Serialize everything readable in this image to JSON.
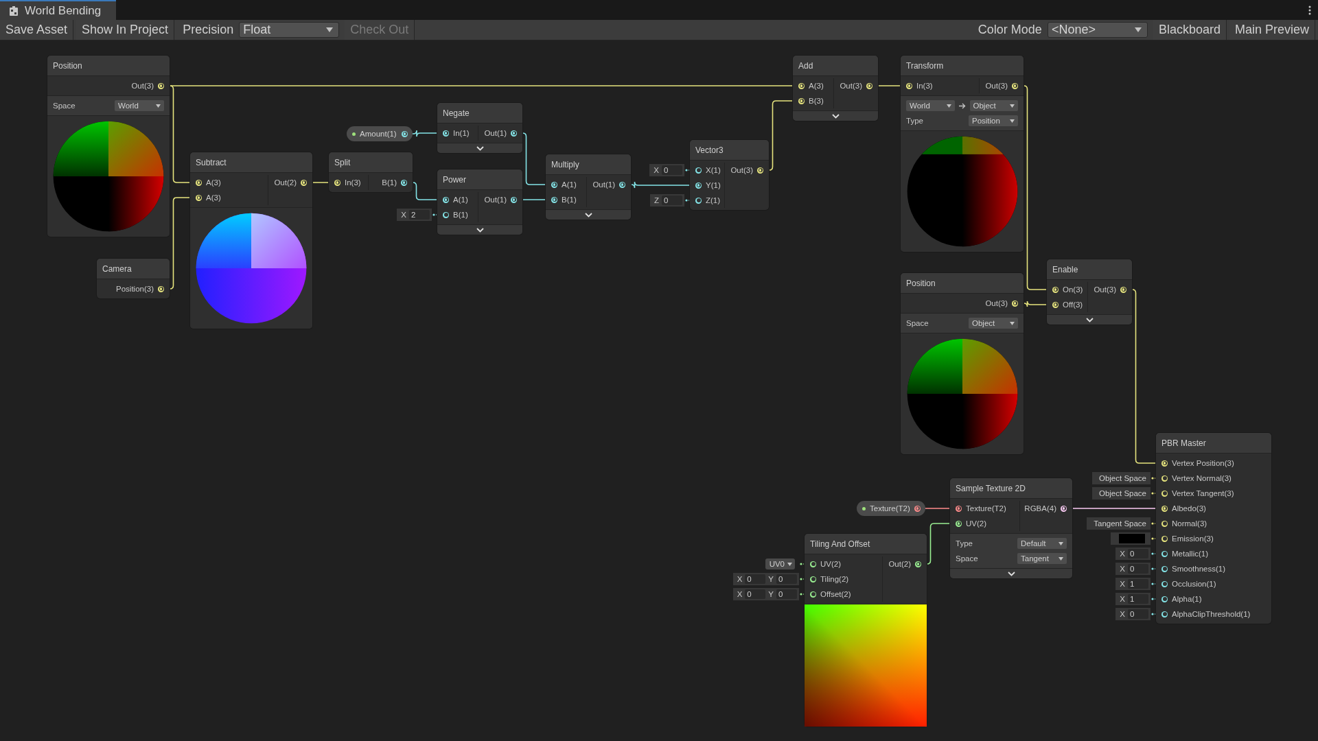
{
  "window": {
    "tab_title": "World Bending"
  },
  "toolbar": {
    "left": [
      {
        "kind": "button",
        "label": "Save Asset",
        "disabled": false
      },
      {
        "kind": "button",
        "label": "Show In Project",
        "disabled": false
      },
      {
        "kind": "dropdown",
        "label": "Precision",
        "value": "Float"
      },
      {
        "kind": "button",
        "label": "Check Out",
        "disabled": true
      }
    ],
    "right": [
      {
        "kind": "dropdown",
        "label": "Color Mode",
        "value": "<None>"
      },
      {
        "kind": "button",
        "label": "Blackboard",
        "disabled": false
      },
      {
        "kind": "button",
        "label": "Main Preview",
        "disabled": false
      }
    ]
  },
  "properties": [
    {
      "label": "Amount(1)",
      "color": "#84e4e7"
    },
    {
      "label": "Texture(T2)",
      "color": "#ff8b8b"
    }
  ],
  "nodes": [
    {
      "title": "Position",
      "outputs": [
        {
          "label": "Out(3)",
          "color": "#e6e47e",
          "connected": true
        }
      ],
      "fields": [
        {
          "kind": "dropdown",
          "label": "Space",
          "value": "World"
        }
      ],
      "preview": {
        "kind": "quadrant-sphere"
      },
      "expand_toggle": false
    },
    {
      "title": "Camera",
      "outputs": [
        {
          "label": "Position(3)",
          "color": "#e6e47e",
          "connected": true
        }
      ],
      "expand_toggle": false
    },
    {
      "title": "Subtract",
      "inputs": [
        {
          "label": "A(3)",
          "color": "#e6e47e",
          "connected": true
        },
        {
          "label": "A(3)",
          "color": "#e6e47e",
          "connected": true
        }
      ],
      "outputs": [
        {
          "label": "Out(2)",
          "color": "#e6e47e",
          "connected": true
        }
      ],
      "preview": {
        "kind": "blue-sphere"
      },
      "expand_toggle": false
    },
    {
      "title": "Split",
      "inputs": [
        {
          "label": "In(3)",
          "color": "#e6e47e",
          "connected": true
        }
      ],
      "outputs": [
        {
          "label": "B(1)",
          "color": "#84e4e7",
          "connected": true
        }
      ],
      "expand_toggle": false
    },
    {
      "title": "Negate",
      "inputs": [
        {
          "label": "In(1)",
          "color": "#84e4e7",
          "connected": true
        }
      ],
      "outputs": [
        {
          "label": "Out(1)",
          "color": "#84e4e7",
          "connected": true
        }
      ],
      "expand_toggle": true
    },
    {
      "title": "Power",
      "inputs": [
        {
          "label": "A(1)",
          "color": "#84e4e7",
          "connected": true
        },
        {
          "label": "B(1)",
          "color": "#84e4e7",
          "connected": false,
          "default": {
            "kind": "vector",
            "fields": [
              {
                "axis": "X",
                "value": "2"
              }
            ]
          }
        }
      ],
      "outputs": [
        {
          "label": "Out(1)",
          "color": "#84e4e7",
          "connected": true
        }
      ],
      "expand_toggle": true
    },
    {
      "title": "Multiply",
      "inputs": [
        {
          "label": "A(1)",
          "color": "#84e4e7",
          "connected": true
        },
        {
          "label": "B(1)",
          "color": "#84e4e7",
          "connected": true
        }
      ],
      "outputs": [
        {
          "label": "Out(1)",
          "color": "#84e4e7",
          "connected": true
        }
      ],
      "expand_toggle": true
    },
    {
      "title": "Vector3",
      "inputs": [
        {
          "label": "X(1)",
          "color": "#84e4e7",
          "connected": false,
          "default": {
            "kind": "vector",
            "fields": [
              {
                "axis": "X",
                "value": "0"
              }
            ]
          }
        },
        {
          "label": "Y(1)",
          "color": "#84e4e7",
          "connected": true
        },
        {
          "label": "Z(1)",
          "color": "#84e4e7",
          "connected": false,
          "default": {
            "kind": "vector",
            "fields": [
              {
                "axis": "Z",
                "value": "0"
              }
            ]
          }
        }
      ],
      "outputs": [
        {
          "label": "Out(3)",
          "color": "#e6e47e",
          "connected": true
        }
      ],
      "expand_toggle": false
    },
    {
      "title": "Add",
      "inputs": [
        {
          "label": "A(3)",
          "color": "#e6e47e",
          "connected": true
        },
        {
          "label": "B(3)",
          "color": "#e6e47e",
          "connected": true
        }
      ],
      "outputs": [
        {
          "label": "Out(3)",
          "color": "#e6e47e",
          "connected": true
        }
      ],
      "expand_toggle": true
    },
    {
      "title": "Transform",
      "inputs": [
        {
          "label": "In(3)",
          "color": "#e6e47e",
          "connected": true
        }
      ],
      "outputs": [
        {
          "label": "Out(3)",
          "color": "#e6e47e",
          "connected": true
        }
      ],
      "fields": [
        {
          "kind": "conversion",
          "from": "World",
          "to": "Object"
        },
        {
          "kind": "dropdown",
          "label": "Type",
          "value": "Position"
        }
      ],
      "preview": {
        "kind": "red-sphere"
      },
      "expand_toggle": false
    },
    {
      "title": "Position",
      "outputs": [
        {
          "label": "Out(3)",
          "color": "#e6e47e",
          "connected": true
        }
      ],
      "fields": [
        {
          "kind": "dropdown",
          "label": "Space",
          "value": "Object"
        }
      ],
      "preview": {
        "kind": "quadrant-sphere"
      },
      "expand_toggle": false
    },
    {
      "title": "Enable",
      "inputs": [
        {
          "label": "On(3)",
          "color": "#e6e47e",
          "connected": true
        },
        {
          "label": "Off(3)",
          "color": "#e6e47e",
          "connected": true
        }
      ],
      "outputs": [
        {
          "label": "Out(3)",
          "color": "#e6e47e",
          "connected": true
        }
      ],
      "expand_toggle": true
    },
    {
      "title": "PBR Master",
      "inputs": [
        {
          "label": "Vertex Position(3)",
          "color": "#e6e47e",
          "connected": true
        },
        {
          "label": "Vertex Normal(3)",
          "color": "#e6e47e",
          "connected": false,
          "default": {
            "kind": "text",
            "value": "Object Space"
          }
        },
        {
          "label": "Vertex Tangent(3)",
          "color": "#e6e47e",
          "connected": false,
          "default": {
            "kind": "text",
            "value": "Object Space"
          }
        },
        {
          "label": "Albedo(3)",
          "color": "#e6e47e",
          "connected": true
        },
        {
          "label": "Normal(3)",
          "color": "#e6e47e",
          "connected": false,
          "default": {
            "kind": "text",
            "value": "Tangent Space"
          }
        },
        {
          "label": "Emission(3)",
          "color": "#e6e47e",
          "connected": false,
          "default": {
            "kind": "color",
            "color": "#000000"
          }
        },
        {
          "label": "Metallic(1)",
          "color": "#84e4e7",
          "connected": false,
          "default": {
            "kind": "vector",
            "fields": [
              {
                "axis": "X",
                "value": "0"
              }
            ]
          }
        },
        {
          "label": "Smoothness(1)",
          "color": "#84e4e7",
          "connected": false,
          "default": {
            "kind": "vector",
            "fields": [
              {
                "axis": "X",
                "value": "0"
              }
            ]
          }
        },
        {
          "label": "Occlusion(1)",
          "color": "#84e4e7",
          "connected": false,
          "default": {
            "kind": "vector",
            "fields": [
              {
                "axis": "X",
                "value": "1"
              }
            ]
          }
        },
        {
          "label": "Alpha(1)",
          "color": "#84e4e7",
          "connected": false,
          "default": {
            "kind": "vector",
            "fields": [
              {
                "axis": "X",
                "value": "1"
              }
            ]
          }
        },
        {
          "label": "AlphaClipThreshold(1)",
          "color": "#84e4e7",
          "connected": false,
          "default": {
            "kind": "vector",
            "fields": [
              {
                "axis": "X",
                "value": "0"
              }
            ]
          }
        }
      ],
      "expand_toggle": false
    },
    {
      "title": "Sample Texture 2D",
      "inputs": [
        {
          "label": "Texture(T2)",
          "color": "#ff8b8b",
          "connected": true
        },
        {
          "label": "UV(2)",
          "color": "#9aef92",
          "connected": true
        }
      ],
      "outputs": [
        {
          "label": "RGBA(4)",
          "color": "#fbcbf4",
          "connected": true
        }
      ],
      "fields": [
        {
          "kind": "dropdown",
          "label": "Type",
          "value": "Default"
        },
        {
          "kind": "dropdown",
          "label": "Space",
          "value": "Tangent"
        }
      ],
      "expand_toggle": true
    },
    {
      "title": "Tiling And Offset",
      "inputs": [
        {
          "label": "UV(2)",
          "color": "#9aef92",
          "connected": false,
          "default": {
            "kind": "dropdown",
            "value": "UV0"
          }
        },
        {
          "label": "Tiling(2)",
          "color": "#9aef92",
          "connected": false,
          "default": {
            "kind": "vector",
            "fields": [
              {
                "axis": "X",
                "value": "0"
              },
              {
                "axis": "Y",
                "value": "0"
              }
            ]
          }
        },
        {
          "label": "Offset(2)",
          "color": "#9aef92",
          "connected": false,
          "default": {
            "kind": "vector",
            "fields": [
              {
                "axis": "X",
                "value": "0"
              },
              {
                "axis": "Y",
                "value": "0"
              }
            ]
          }
        }
      ],
      "outputs": [
        {
          "label": "Out(2)",
          "color": "#9aef92",
          "connected": true
        }
      ],
      "preview": {
        "kind": "uv-square"
      },
      "expand_toggle": false
    }
  ]
}
